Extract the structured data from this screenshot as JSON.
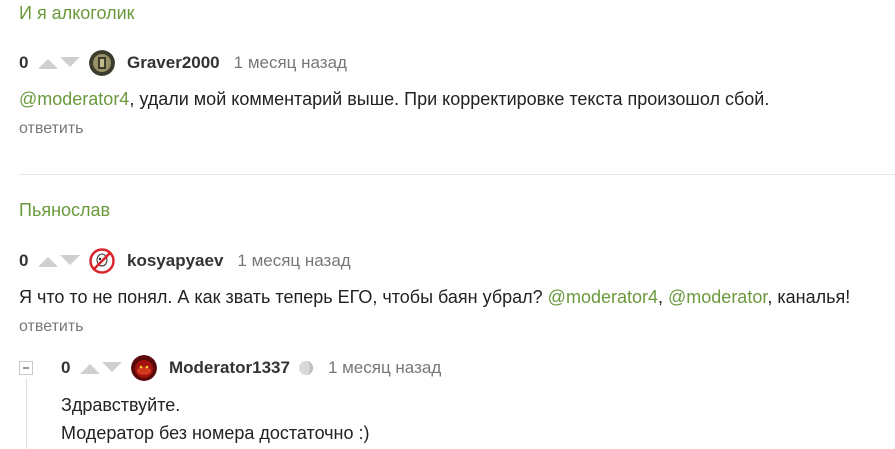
{
  "thread1": {
    "title": "И я алкоголик",
    "comment": {
      "score": "0",
      "username": "Graver2000",
      "time": "1 месяц назад",
      "mention": "@moderator4",
      "text": ", удали мой комментарий выше. При корректировке текста произошол сбой.",
      "reply": "ответить"
    }
  },
  "thread2": {
    "title": "Пьянослав",
    "comment": {
      "score": "0",
      "username": "kosyapyaev",
      "time": "1 месяц назад",
      "text_before": "Я что то не понял. А как звать теперь ЕГО, чтобы баян убрал? ",
      "mention1": "@moderator4",
      "sep": ", ",
      "mention2": "@moderator",
      "text_after": ", каналья!",
      "reply": "ответить"
    },
    "child": {
      "score": "0",
      "username": "Moderator1337",
      "time": "1 месяц назад",
      "line1": "Здравствуйте.",
      "line2": "Модератор без номера достаточно :)"
    }
  }
}
